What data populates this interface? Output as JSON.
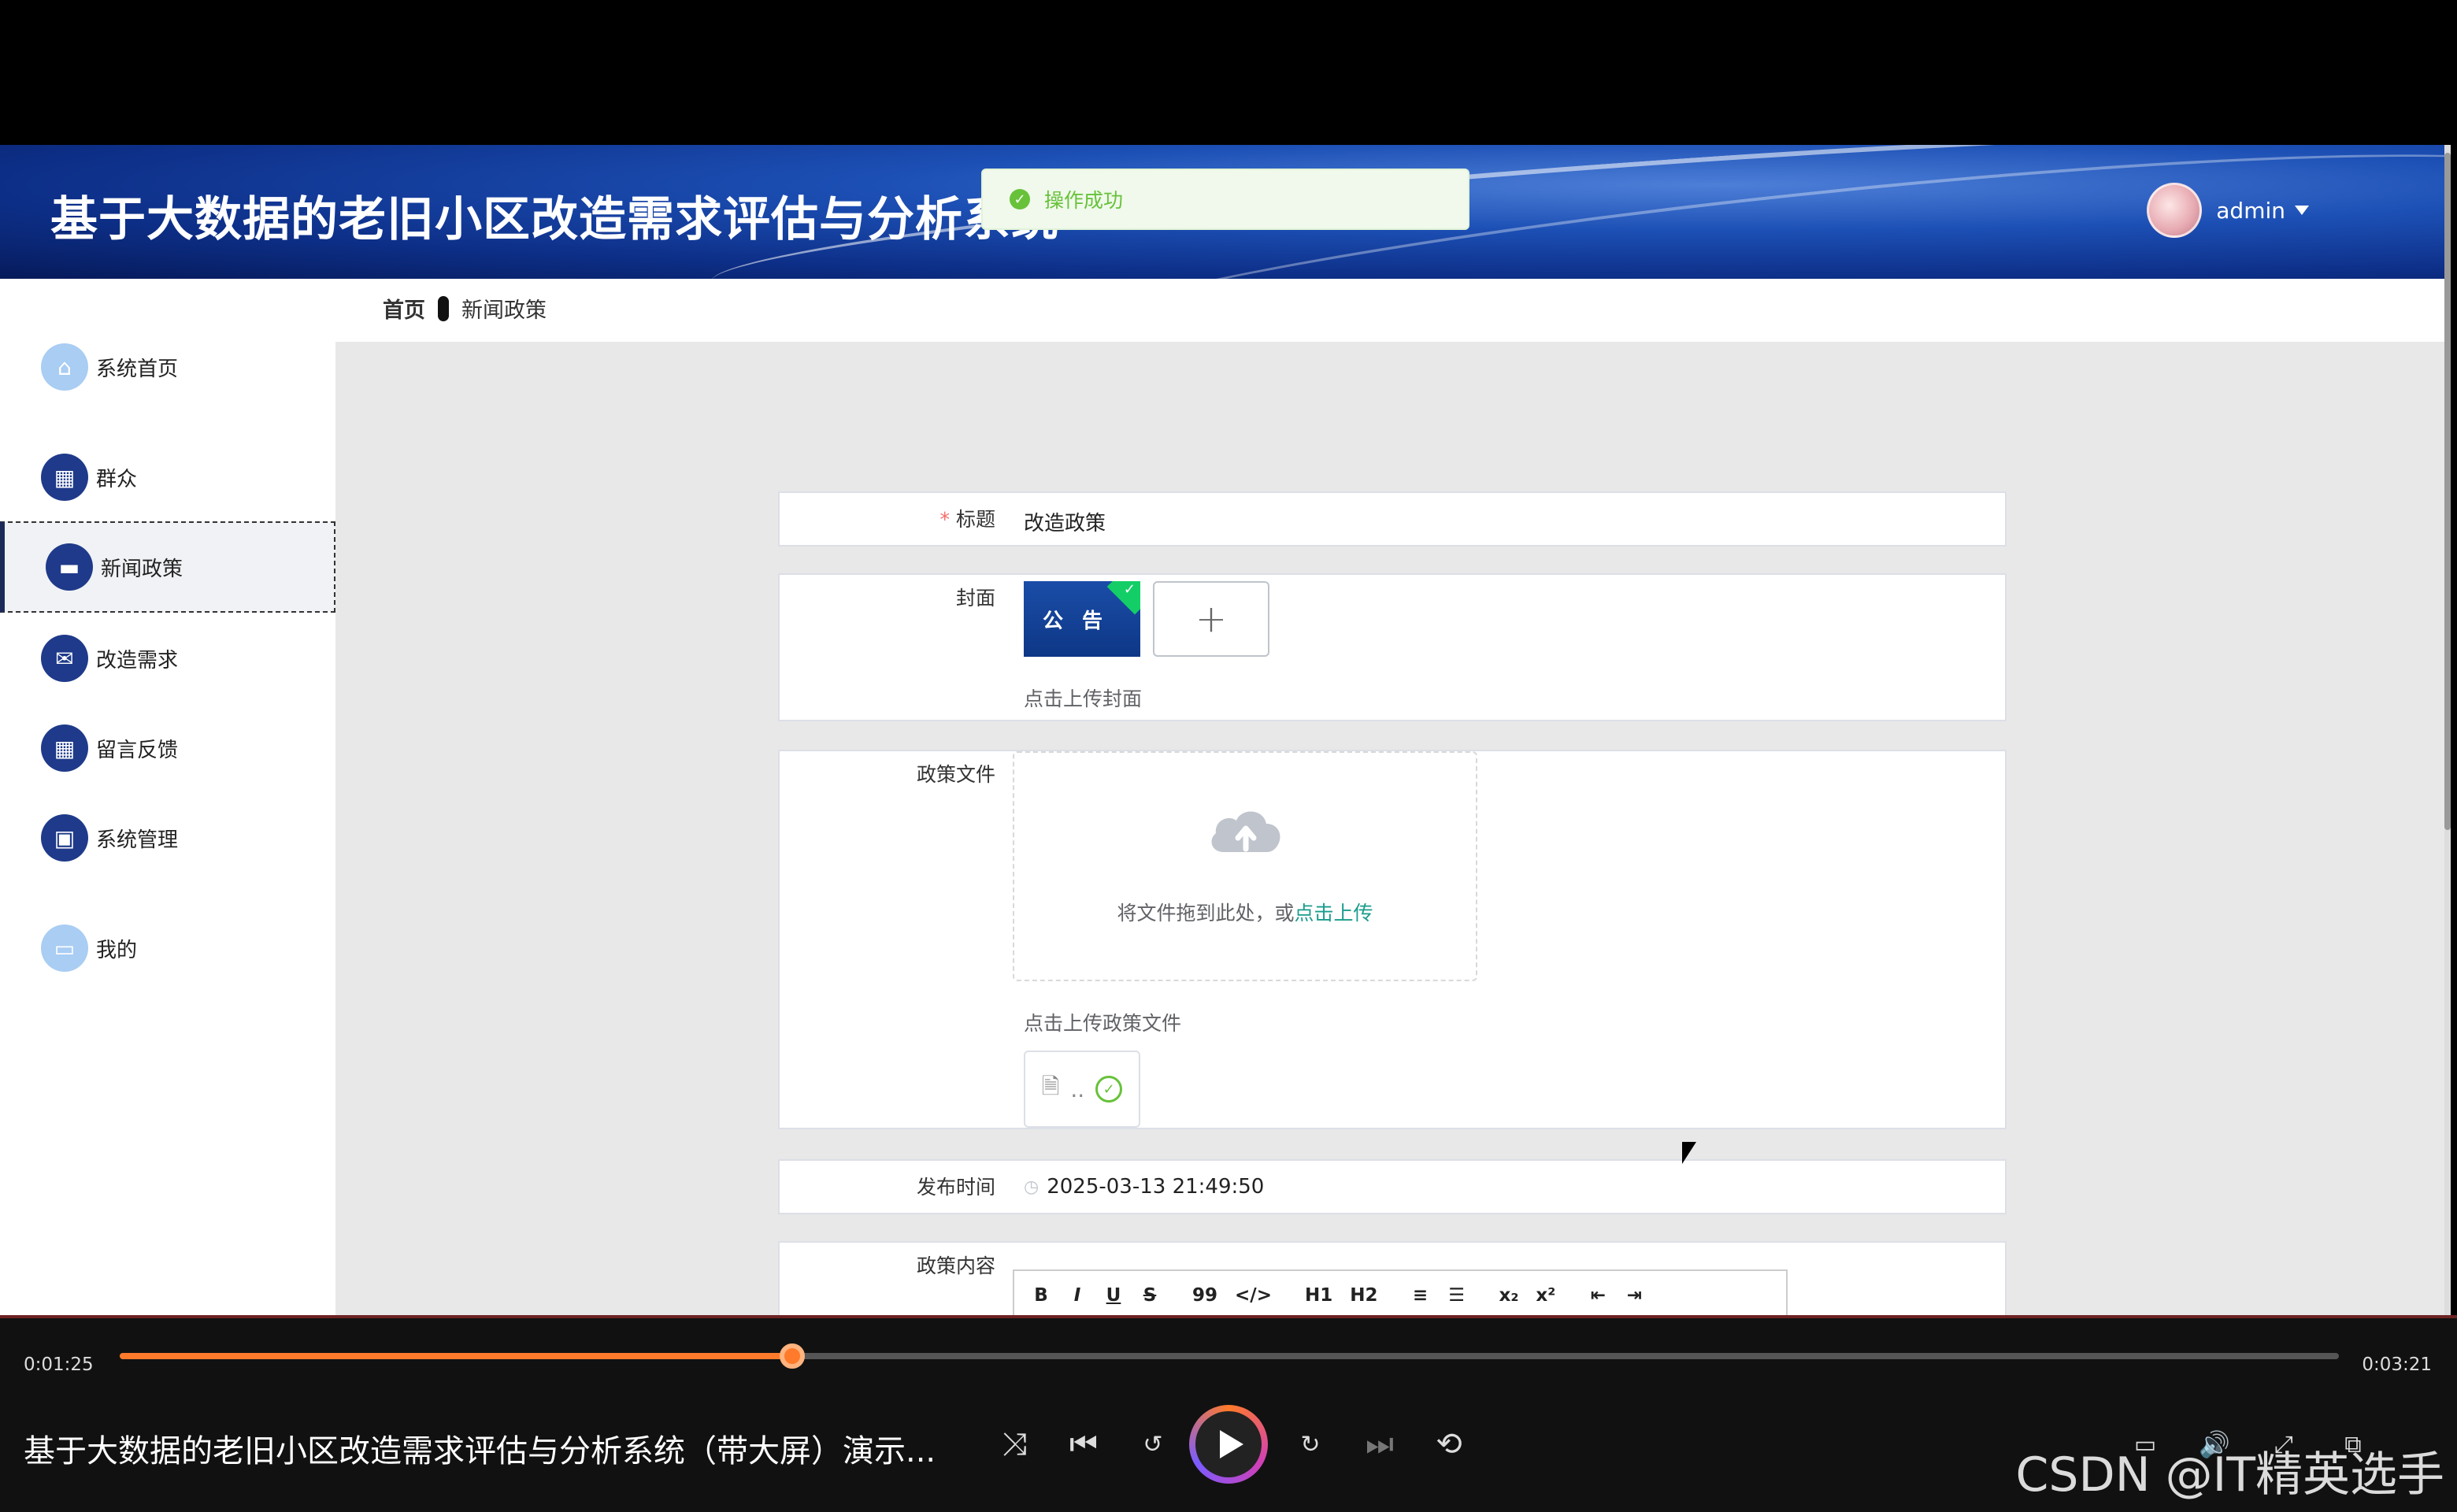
{
  "app": {
    "title": "基于大数据的老旧小区改造需求评估与分析系统",
    "user_name": "admin"
  },
  "toast": {
    "text": "操作成功"
  },
  "breadcrumb": {
    "home": "首页",
    "current": "新闻政策"
  },
  "sidebar": {
    "items": [
      {
        "label": "系统首页",
        "icon": "home-icon"
      },
      {
        "label": "群众",
        "icon": "grid-icon"
      },
      {
        "label": "新闻政策",
        "icon": "chat-icon"
      },
      {
        "label": "改造需求",
        "icon": "ticket-icon"
      },
      {
        "label": "留言反馈",
        "icon": "apps-icon"
      },
      {
        "label": "系统管理",
        "icon": "briefcase-icon"
      },
      {
        "label": "我的",
        "icon": "card-icon"
      }
    ]
  },
  "form": {
    "title_label": "标题",
    "title_value": "改造政策",
    "cover_label": "封面",
    "cover_thumb_text": "公告",
    "cover_hint": "点击上传封面",
    "file_label": "政策文件",
    "drop_text": "将文件拖到此处，或",
    "drop_link": "点击上传",
    "file_hint": "点击上传政策文件",
    "file_name": "..",
    "time_label": "发布时间",
    "time_value": "2025-03-13 21:49:50",
    "content_label": "政策内容",
    "toolbar": [
      "B",
      "I",
      "U",
      "S",
      "99",
      "</>",
      "H1",
      "H2",
      "≡",
      "☰",
      "x₂",
      "x²",
      "⇤",
      "⇥"
    ]
  },
  "player": {
    "current_time": "0:01:25",
    "total_time": "0:03:21",
    "progress": 0.303,
    "video_title": "基于大数据的老旧小区改造需求评估与分析系统（带大屏）演示...",
    "watermark": "CSDN @IT精英选手",
    "accent": "#ff7a2a"
  }
}
